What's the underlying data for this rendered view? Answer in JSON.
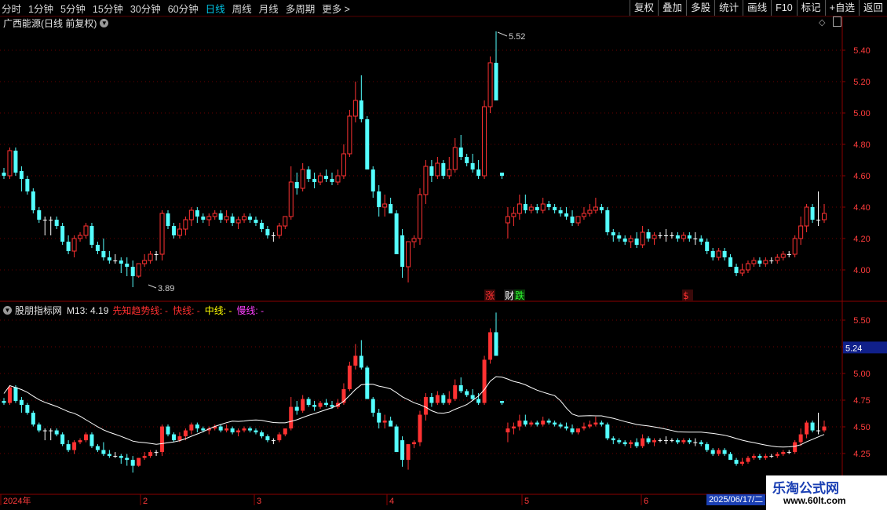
{
  "toolbar": {
    "periods": [
      "分时",
      "1分钟",
      "5分钟",
      "15分钟",
      "30分钟",
      "60分钟",
      "日线",
      "周线",
      "月线",
      "多周期",
      "更多 >"
    ],
    "active_period": "日线",
    "buttons": [
      "复权",
      "叠加",
      "多股",
      "统计",
      "画线",
      "F10",
      "标记",
      "+自选",
      "返回"
    ]
  },
  "main_pane": {
    "title": "广西能源(日线 前复权)",
    "y_ticks": [
      "5.40",
      "5.20",
      "5.00",
      "4.80",
      "4.60",
      "4.40",
      "4.20",
      "4.00"
    ],
    "high_label": "5.52",
    "low_label": "3.89",
    "event_markers": [
      "涨",
      "财",
      "跌",
      "$"
    ]
  },
  "sub_pane": {
    "title": "股朋指标网",
    "m13_label": "M13: 4.19",
    "legend": [
      {
        "text": "先知趋势线: -",
        "color": "#ff3030"
      },
      {
        "text": "快线: -",
        "color": "#ff3030"
      },
      {
        "text": "中线: -",
        "color": "#ffff00"
      },
      {
        "text": "慢线: -",
        "color": "#ff40ff"
      }
    ],
    "y_ticks": [
      "5.50",
      "5.25",
      "5.00",
      "4.75",
      "4.50",
      "4.25"
    ],
    "current_value": "5.24"
  },
  "x_axis": {
    "labels": [
      "2024年",
      "2",
      "3",
      "4",
      "5",
      "6"
    ],
    "cursor_date": "2025/06/17/二"
  },
  "watermark": {
    "line1": "乐淘公式网",
    "line2": "www.60lt.com"
  },
  "chart_data": {
    "type": "candlestick",
    "price_range": [
      3.9,
      5.52
    ],
    "up_color": "#ff3232",
    "down_color": "#54ffff",
    "candles": [
      [
        4.62,
        4.65,
        4.58,
        4.6
      ],
      [
        4.6,
        4.78,
        4.58,
        4.76
      ],
      [
        4.76,
        4.78,
        4.6,
        4.62
      ],
      [
        4.63,
        4.66,
        4.5,
        4.58
      ],
      [
        4.58,
        4.6,
        4.48,
        4.5
      ],
      [
        4.5,
        4.52,
        4.36,
        4.38
      ],
      [
        4.38,
        4.4,
        4.3,
        4.32
      ],
      [
        4.32,
        4.34,
        4.22,
        4.32
      ],
      [
        4.32,
        4.34,
        4.22,
        4.32
      ],
      [
        4.32,
        4.34,
        4.26,
        4.28
      ],
      [
        4.28,
        4.3,
        4.16,
        4.18
      ],
      [
        4.18,
        4.22,
        4.1,
        4.12
      ],
      [
        4.12,
        4.22,
        4.08,
        4.2
      ],
      [
        4.2,
        4.24,
        4.18,
        4.22
      ],
      [
        4.22,
        4.3,
        4.2,
        4.28
      ],
      [
        4.28,
        4.3,
        4.14,
        4.16
      ],
      [
        4.16,
        4.18,
        4.1,
        4.12
      ],
      [
        4.12,
        4.2,
        4.06,
        4.08
      ],
      [
        4.08,
        4.12,
        4.04,
        4.06
      ],
      [
        4.06,
        4.1,
        4.04,
        4.06
      ],
      [
        4.06,
        4.08,
        3.98,
        4.04
      ],
      [
        4.04,
        4.08,
        3.96,
        4.02
      ],
      [
        4.02,
        4.06,
        3.89,
        3.96
      ],
      [
        3.96,
        4.04,
        3.95,
        4.04
      ],
      [
        4.04,
        4.1,
        4.02,
        4.06
      ],
      [
        4.06,
        4.12,
        4.04,
        4.1
      ],
      [
        4.1,
        4.12,
        4.06,
        4.1
      ],
      [
        4.1,
        4.38,
        4.06,
        4.36
      ],
      [
        4.36,
        4.38,
        4.26,
        4.28
      ],
      [
        4.28,
        4.3,
        4.2,
        4.22
      ],
      [
        4.22,
        4.3,
        4.2,
        4.26
      ],
      [
        4.26,
        4.34,
        4.22,
        4.32
      ],
      [
        4.32,
        4.4,
        4.28,
        4.38
      ],
      [
        4.38,
        4.4,
        4.3,
        4.34
      ],
      [
        4.34,
        4.36,
        4.3,
        4.32
      ],
      [
        4.32,
        4.36,
        4.28,
        4.34
      ],
      [
        4.34,
        4.38,
        4.32,
        4.36
      ],
      [
        4.36,
        4.38,
        4.3,
        4.32
      ],
      [
        4.32,
        4.38,
        4.3,
        4.34
      ],
      [
        4.34,
        4.36,
        4.28,
        4.3
      ],
      [
        4.3,
        4.34,
        4.26,
        4.32
      ],
      [
        4.32,
        4.36,
        4.3,
        4.34
      ],
      [
        4.34,
        4.36,
        4.3,
        4.32
      ],
      [
        4.32,
        4.34,
        4.28,
        4.3
      ],
      [
        4.3,
        4.32,
        4.24,
        4.26
      ],
      [
        4.26,
        4.28,
        4.2,
        4.22
      ],
      [
        4.22,
        4.24,
        4.18,
        4.22
      ],
      [
        4.22,
        4.3,
        4.2,
        4.28
      ],
      [
        4.28,
        4.34,
        4.26,
        4.34
      ],
      [
        4.34,
        4.66,
        4.32,
        4.56
      ],
      [
        4.56,
        4.62,
        4.48,
        4.52
      ],
      [
        4.52,
        4.68,
        4.5,
        4.64
      ],
      [
        4.64,
        4.66,
        4.56,
        4.58
      ],
      [
        4.58,
        4.62,
        4.52,
        4.56
      ],
      [
        4.56,
        4.62,
        4.54,
        4.6
      ],
      [
        4.6,
        4.64,
        4.56,
        4.58
      ],
      [
        4.58,
        4.62,
        4.54,
        4.56
      ],
      [
        4.56,
        4.64,
        4.54,
        4.6
      ],
      [
        4.6,
        4.8,
        4.58,
        4.74
      ],
      [
        4.74,
        5.02,
        4.72,
        4.98
      ],
      [
        4.98,
        5.2,
        4.94,
        5.08
      ],
      [
        5.08,
        5.24,
        4.94,
        4.96
      ],
      [
        4.96,
        4.98,
        4.66,
        4.64
      ],
      [
        4.64,
        4.66,
        4.46,
        4.5
      ],
      [
        4.5,
        4.54,
        4.34,
        4.4
      ],
      [
        4.4,
        4.48,
        4.34,
        4.42
      ],
      [
        4.42,
        4.46,
        4.38,
        4.36
      ],
      [
        4.36,
        4.38,
        4.18,
        4.1
      ],
      [
        4.22,
        4.26,
        3.95,
        4.02
      ],
      [
        4.02,
        4.18,
        3.92,
        4.18
      ],
      [
        4.18,
        4.22,
        4.14,
        4.2
      ],
      [
        4.2,
        4.52,
        4.16,
        4.48
      ],
      [
        4.48,
        4.7,
        4.42,
        4.66
      ],
      [
        4.66,
        4.7,
        4.56,
        4.6
      ],
      [
        4.6,
        4.72,
        4.58,
        4.68
      ],
      [
        4.68,
        4.7,
        4.58,
        4.6
      ],
      [
        4.6,
        4.72,
        4.58,
        4.64
      ],
      [
        4.64,
        4.84,
        4.62,
        4.78
      ],
      [
        4.78,
        4.86,
        4.7,
        4.72
      ],
      [
        4.72,
        4.74,
        4.66,
        4.68
      ],
      [
        4.68,
        4.74,
        4.62,
        4.64
      ],
      [
        4.64,
        4.7,
        4.58,
        4.6
      ],
      [
        4.6,
        5.08,
        4.58,
        5.04
      ],
      [
        5.04,
        5.36,
        5.0,
        5.32
      ],
      [
        5.32,
        5.52,
        5.26,
        5.08
      ],
      [
        4.62,
        4.62,
        4.58,
        4.6
      ],
      [
        4.3,
        4.4,
        4.2,
        4.34
      ],
      [
        4.34,
        4.4,
        4.28,
        4.36
      ],
      [
        4.36,
        4.48,
        4.32,
        4.42
      ],
      [
        4.42,
        4.48,
        4.36,
        4.38
      ],
      [
        4.38,
        4.42,
        4.36,
        4.4
      ],
      [
        4.4,
        4.42,
        4.36,
        4.38
      ],
      [
        4.38,
        4.46,
        4.36,
        4.42
      ],
      [
        4.42,
        4.44,
        4.38,
        4.4
      ],
      [
        4.4,
        4.42,
        4.36,
        4.38
      ],
      [
        4.38,
        4.4,
        4.34,
        4.36
      ],
      [
        4.36,
        4.4,
        4.32,
        4.34
      ],
      [
        4.34,
        4.38,
        4.28,
        4.3
      ],
      [
        4.3,
        4.34,
        4.28,
        4.34
      ],
      [
        4.34,
        4.4,
        4.32,
        4.36
      ],
      [
        4.36,
        4.42,
        4.34,
        4.38
      ],
      [
        4.38,
        4.46,
        4.36,
        4.4
      ],
      [
        4.4,
        4.42,
        4.36,
        4.38
      ],
      [
        4.38,
        4.4,
        4.22,
        4.24
      ],
      [
        4.24,
        4.26,
        4.18,
        4.22
      ],
      [
        4.22,
        4.24,
        4.18,
        4.2
      ],
      [
        4.2,
        4.22,
        4.16,
        4.18
      ],
      [
        4.18,
        4.22,
        4.14,
        4.2
      ],
      [
        4.2,
        4.24,
        4.14,
        4.16
      ],
      [
        4.16,
        4.28,
        4.14,
        4.24
      ],
      [
        4.24,
        4.26,
        4.18,
        4.2
      ],
      [
        4.2,
        4.24,
        4.16,
        4.22
      ],
      [
        4.22,
        4.24,
        4.2,
        4.22
      ],
      [
        4.22,
        4.26,
        4.18,
        4.22
      ],
      [
        4.22,
        4.24,
        4.2,
        4.22
      ],
      [
        4.22,
        4.24,
        4.18,
        4.2
      ],
      [
        4.2,
        4.24,
        4.18,
        4.22
      ],
      [
        4.22,
        4.24,
        4.18,
        4.2
      ],
      [
        4.2,
        4.24,
        4.16,
        4.2
      ],
      [
        4.2,
        4.22,
        4.16,
        4.18
      ],
      [
        4.18,
        4.2,
        4.1,
        4.12
      ],
      [
        4.12,
        4.14,
        4.06,
        4.08
      ],
      [
        4.08,
        4.14,
        4.06,
        4.12
      ],
      [
        4.12,
        4.14,
        4.06,
        4.08
      ],
      [
        4.08,
        4.1,
        4.02,
        4.02
      ],
      [
        4.02,
        4.04,
        3.96,
        3.98
      ],
      [
        3.98,
        4.04,
        3.96,
        4.0
      ],
      [
        4.0,
        4.06,
        3.98,
        4.04
      ],
      [
        4.04,
        4.08,
        4.02,
        4.06
      ],
      [
        4.06,
        4.08,
        4.02,
        4.04
      ],
      [
        4.04,
        4.08,
        4.02,
        4.06
      ],
      [
        4.06,
        4.08,
        4.04,
        4.06
      ],
      [
        4.06,
        4.1,
        4.04,
        4.08
      ],
      [
        4.08,
        4.12,
        4.06,
        4.1
      ],
      [
        4.1,
        4.12,
        4.08,
        4.1
      ],
      [
        4.1,
        4.22,
        4.08,
        4.2
      ],
      [
        4.2,
        4.34,
        4.16,
        4.28
      ],
      [
        4.28,
        4.42,
        4.24,
        4.4
      ],
      [
        4.4,
        4.42,
        4.3,
        4.32
      ],
      [
        4.32,
        4.5,
        4.28,
        4.32
      ],
      [
        4.32,
        4.42,
        4.3,
        4.36
      ]
    ]
  }
}
